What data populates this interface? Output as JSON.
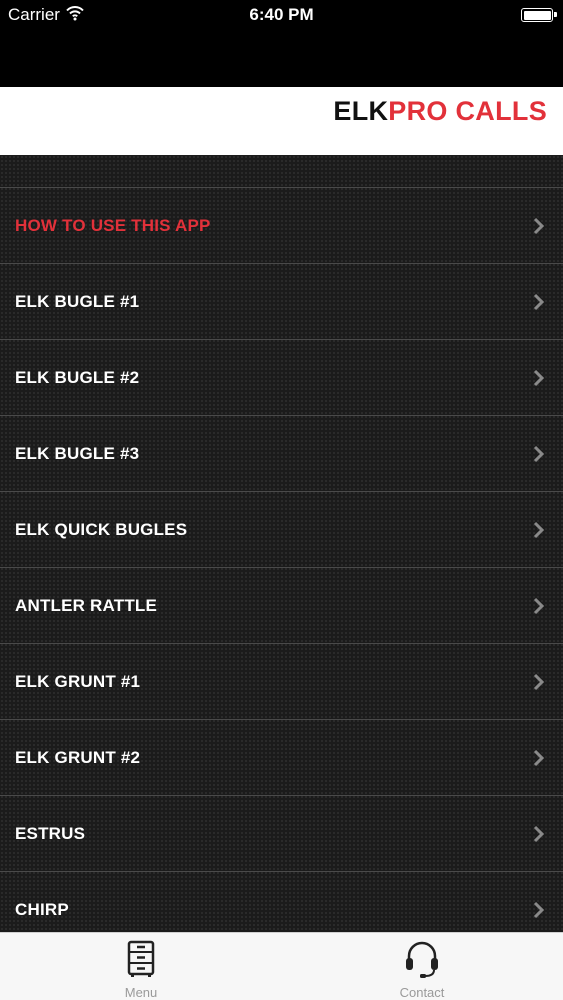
{
  "status_bar": {
    "carrier": "Carrier",
    "time": "6:40 PM"
  },
  "brand": {
    "part1": "ELK",
    "part2": "PRO CALLS"
  },
  "menu": {
    "items": [
      {
        "label": "HOW TO USE THIS APP",
        "highlight": true
      },
      {
        "label": "ELK BUGLE #1"
      },
      {
        "label": "ELK BUGLE #2"
      },
      {
        "label": "ELK BUGLE #3"
      },
      {
        "label": "ELK QUICK BUGLES"
      },
      {
        "label": "ANTLER RATTLE"
      },
      {
        "label": "ELK GRUNT #1"
      },
      {
        "label": "ELK GRUNT #2"
      },
      {
        "label": "ESTRUS"
      },
      {
        "label": "CHIRP"
      }
    ]
  },
  "tabs": [
    {
      "label": "Menu",
      "icon": "cabinet-icon"
    },
    {
      "label": "Contact",
      "icon": "headset-icon"
    }
  ],
  "colors": {
    "accent": "#e2313a",
    "background": "#1b1b1b",
    "header": "#000000"
  }
}
